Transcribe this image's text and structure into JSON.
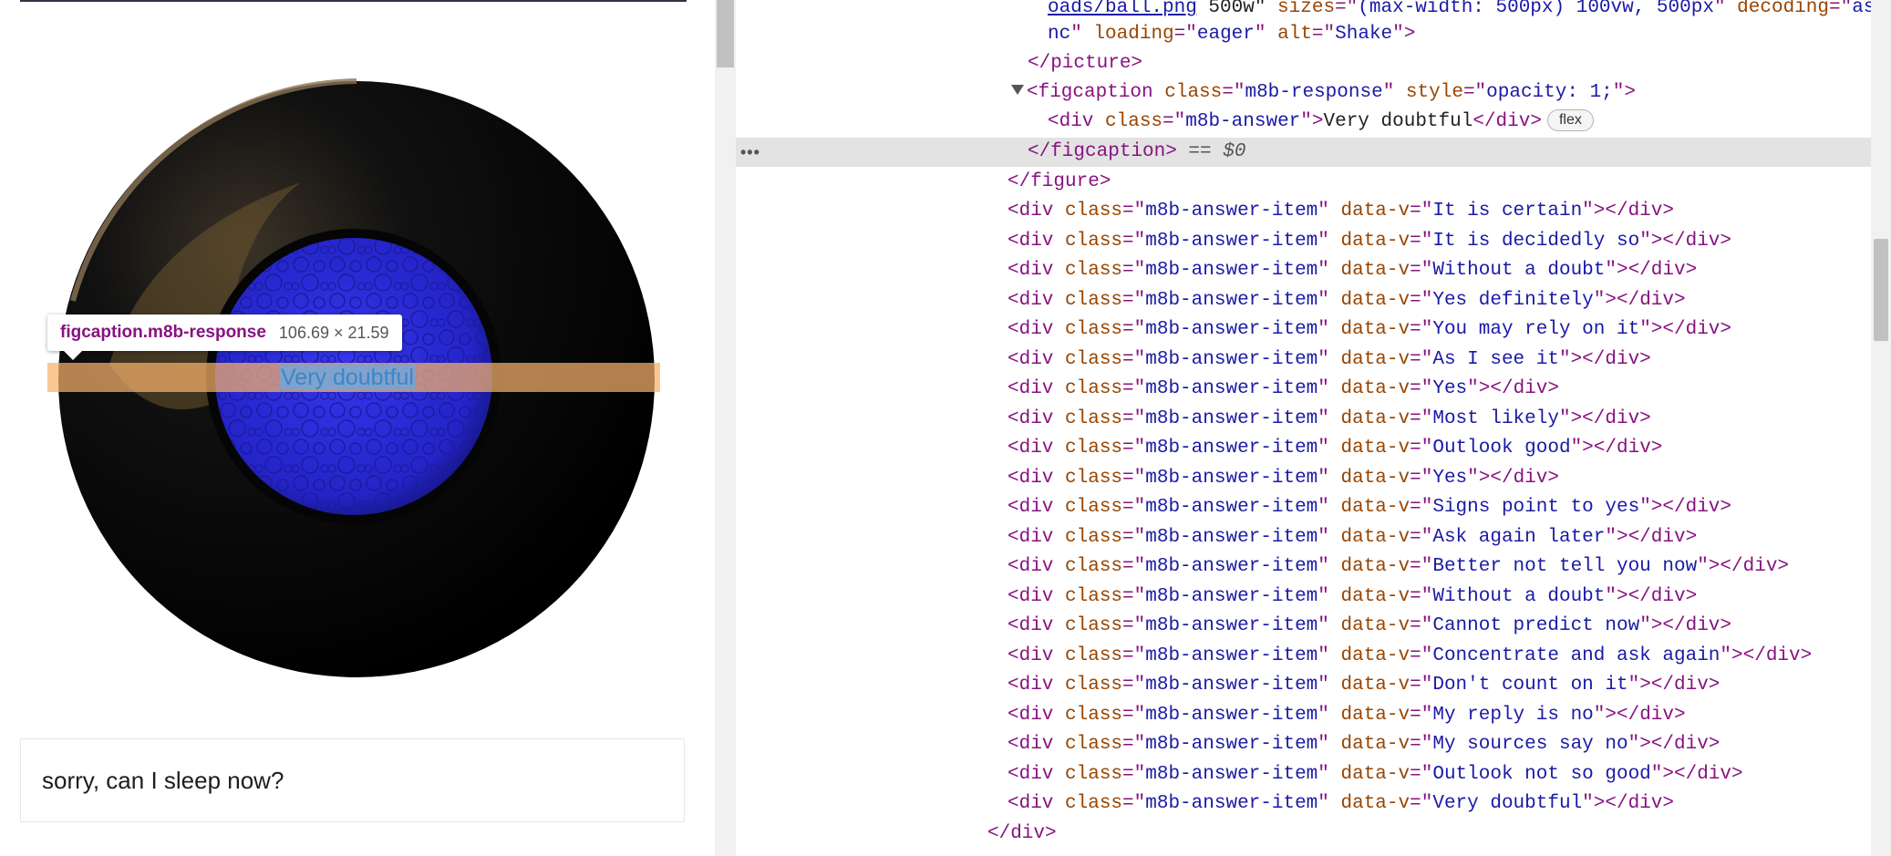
{
  "page": {
    "answer_text": "Very doubtful",
    "tooltip": {
      "selector": "figcaption.m8b-response",
      "dimensions": "106.69 × 21.59"
    },
    "question": "sorry, can I sleep now?"
  },
  "devtools": {
    "line0": {
      "link": "oads/ball.png",
      "rest_a": " 500w\" ",
      "attr_sizes": "sizes",
      "eq": "=\"",
      "val_sizes": "(max-width: 500px) 100vw, 500px",
      "close_q": "\" ",
      "attr_decoding": "decoding",
      "eq2": "=\"",
      "val_decoding_a": "asy"
    },
    "line1": {
      "val_decoding_b": "nc",
      "close_q": "\" ",
      "attr_loading": "loading",
      "eq": "=\"",
      "val_loading": "eager",
      "close_q2": "\" ",
      "attr_alt": "alt",
      "eq2": "=\"",
      "val_alt": "Shake",
      "end": "\">"
    },
    "line2": {
      "tag": "</picture>"
    },
    "line3": {
      "open": "<figcaption ",
      "attr_class": "class",
      "eq": "=\"",
      "val_class": "m8b-response",
      "close_q": "\" ",
      "attr_style": "style",
      "eq2": "=\"",
      "val_style": "opacity: 1;",
      "end": "\">"
    },
    "line4": {
      "open": "<div ",
      "attr_class": "class",
      "eq": "=\"",
      "val_class": "m8b-answer",
      "end": "\">",
      "text": "Very doubtful",
      "close": "</div>",
      "badge": "flex"
    },
    "line5": {
      "ellipsis": "•••",
      "tag": "</figcaption>",
      "dollar": " == $0"
    },
    "line6": {
      "tag": "</figure>"
    },
    "answer_items": [
      "It is certain",
      "It is decidedly so",
      "Without a doubt",
      "Yes definitely",
      "You may rely on it",
      "As I see it",
      "Yes",
      "Most likely",
      "Outlook good",
      "Yes",
      "Signs point to yes",
      "Ask again later",
      "Better not tell you now",
      "Without a doubt",
      "Cannot predict now",
      "Concentrate and ask again",
      "Don't count on it",
      "My reply is no",
      "My sources say no",
      "Outlook not so good",
      "Very doubtful"
    ],
    "item_tokens": {
      "open": "<div ",
      "attr_class": "class",
      "eq": "=\"",
      "val_class": "m8b-answer-item",
      "sep": "\" ",
      "attr_data": "data-v",
      "eq2": "=\"",
      "end": "\"></div>"
    },
    "closing_div": "</div>"
  },
  "colors": {
    "tag": "#881280",
    "attr": "#994500",
    "value": "#1a1aa6",
    "highlight": "#f6b26b",
    "selection": "#6fa8dc",
    "ball_blue": "#2a2ad8"
  }
}
